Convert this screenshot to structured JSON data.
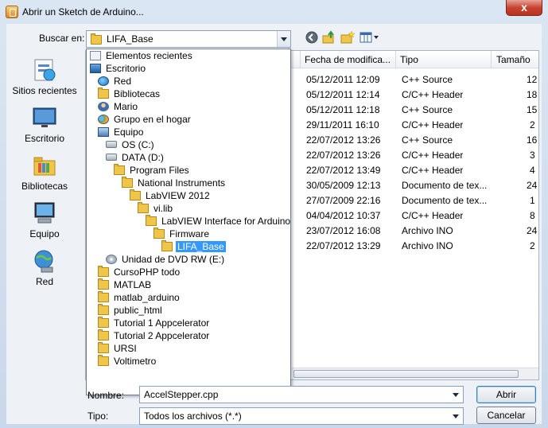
{
  "window": {
    "title": "Abrir un Sketch de Arduino...",
    "close_glyph": "x"
  },
  "lookin": {
    "label": "Buscar en:",
    "value": "LIFA_Base"
  },
  "toolbar": {
    "icons": [
      "back-icon",
      "up-folder-icon",
      "new-folder-icon",
      "view-menu-icon"
    ]
  },
  "places": [
    {
      "label": "Sitios recientes",
      "icon": "recent-places-icon"
    },
    {
      "label": "Escritorio",
      "icon": "desktop-icon"
    },
    {
      "label": "Bibliotecas",
      "icon": "libraries-icon"
    },
    {
      "label": "Equipo",
      "icon": "computer-icon"
    },
    {
      "label": "Red",
      "icon": "network-icon"
    }
  ],
  "filelist": {
    "columns": [
      "Fecha de modifica...",
      "Tipo",
      "Tamaño"
    ],
    "rows": [
      {
        "date": "05/12/2011 12:09",
        "type": "C++ Source",
        "size": "12"
      },
      {
        "date": "05/12/2011 12:14",
        "type": "C/C++ Header",
        "size": "18"
      },
      {
        "date": "05/12/2011 12:18",
        "type": "C++ Source",
        "size": "15"
      },
      {
        "date": "29/11/2011 16:10",
        "type": "C/C++ Header",
        "size": "2"
      },
      {
        "date": "22/07/2012 13:26",
        "type": "C++ Source",
        "size": "16"
      },
      {
        "date": "22/07/2012 13:26",
        "type": "C/C++ Header",
        "size": "3"
      },
      {
        "date": "22/07/2012 13:49",
        "type": "C/C++ Header",
        "size": "4"
      },
      {
        "date": "30/05/2009 12:13",
        "type": "Documento de tex...",
        "size": "24"
      },
      {
        "date": "27/07/2009 22:16",
        "type": "Documento de tex...",
        "size": "1"
      },
      {
        "date": "04/04/2012 10:37",
        "type": "C/C++ Header",
        "size": "8"
      },
      {
        "date": "23/07/2012 16:08",
        "type": "Archivo INO",
        "size": "24"
      },
      {
        "date": "22/07/2012 13:29",
        "type": "Archivo INO",
        "size": "2"
      }
    ]
  },
  "dropdown": {
    "items": [
      {
        "label": "Elementos recientes",
        "icon": "recent"
      },
      {
        "label": "Escritorio",
        "icon": "monitor"
      },
      {
        "label": "Red",
        "icon": "net"
      },
      {
        "label": "Bibliotecas",
        "icon": "folder"
      },
      {
        "label": "Mario",
        "icon": "user"
      },
      {
        "label": "Grupo en el hogar",
        "icon": "home"
      },
      {
        "label": "Equipo",
        "icon": "pc"
      },
      {
        "label": "OS (C:)",
        "icon": "drive"
      },
      {
        "label": "DATA (D:)",
        "icon": "drive"
      },
      {
        "label": "Program Files",
        "icon": "folder"
      },
      {
        "label": "National Instruments",
        "icon": "folder"
      },
      {
        "label": "LabVIEW 2012",
        "icon": "folder"
      },
      {
        "label": "vi.lib",
        "icon": "folder"
      },
      {
        "label": "LabVIEW Interface for Arduino",
        "icon": "folder"
      },
      {
        "label": "Firmware",
        "icon": "folder"
      },
      {
        "label": "LIFA_Base",
        "icon": "folder"
      },
      {
        "label": "Unidad de DVD RW (E:)",
        "icon": "dvd"
      },
      {
        "label": "CursoPHP todo",
        "icon": "folder"
      },
      {
        "label": "MATLAB",
        "icon": "folder"
      },
      {
        "label": "matlab_arduino",
        "icon": "folder"
      },
      {
        "label": "public_html",
        "icon": "folder"
      },
      {
        "label": "Tutorial 1 Appcelerator",
        "icon": "folder"
      },
      {
        "label": "Tutorial 2 Appcelerator",
        "icon": "folder"
      },
      {
        "label": "URSI",
        "icon": "folder"
      },
      {
        "label": "Voltimetro",
        "icon": "folder"
      }
    ],
    "selected": "LIFA_Base"
  },
  "filename": {
    "label": "Nombre:",
    "value": "AccelStepper.cpp"
  },
  "filetype": {
    "label": "Tipo:",
    "value": "Todos los archivos (*.*)"
  },
  "buttons": {
    "open": "Abrir",
    "cancel": "Cancelar"
  }
}
